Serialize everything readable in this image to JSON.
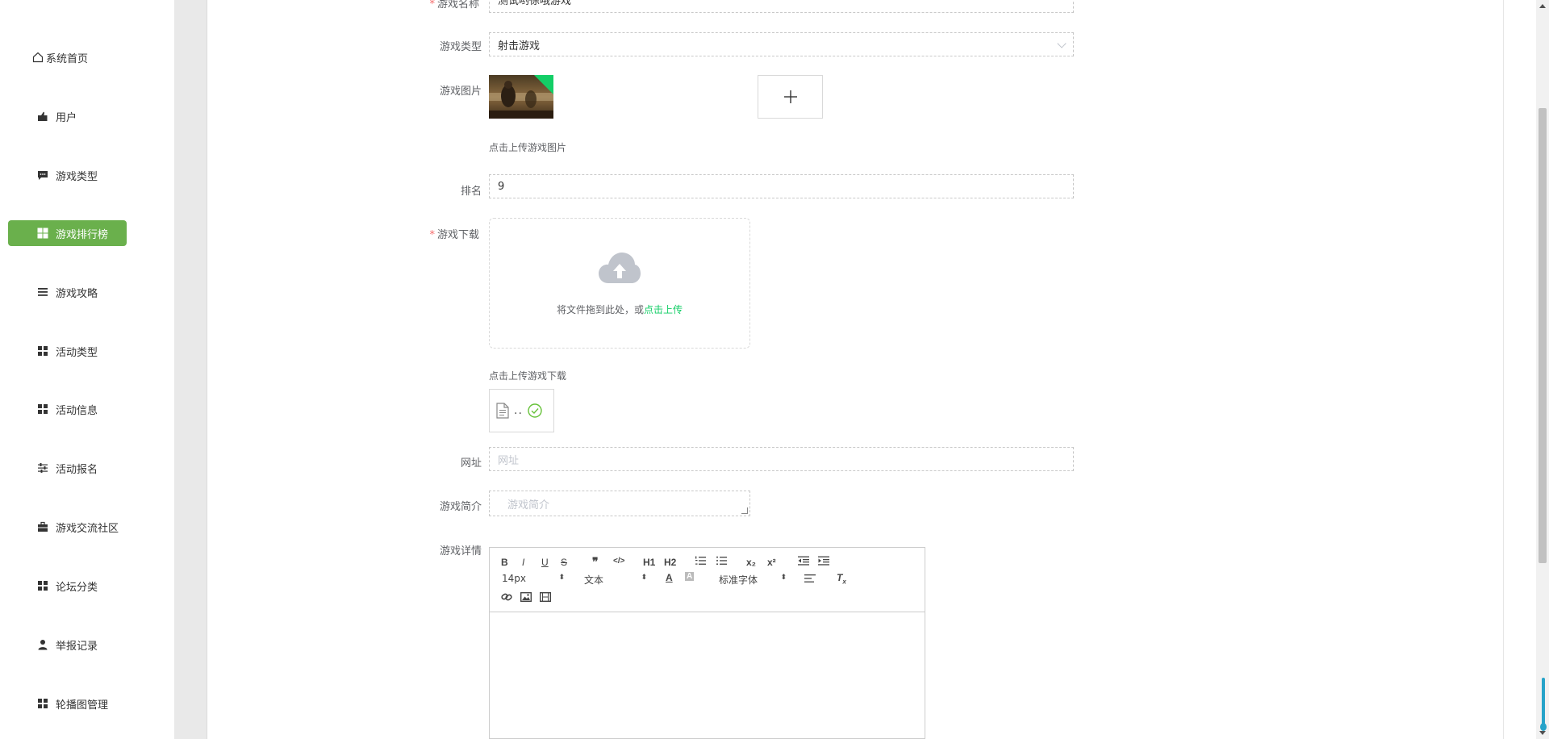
{
  "sidebar": {
    "items": [
      {
        "label": "系统首页",
        "icon": "home-icon",
        "active": false
      },
      {
        "label": "用户",
        "icon": "user-thumb-icon",
        "active": false
      },
      {
        "label": "游戏类型",
        "icon": "chat-icon",
        "active": false
      },
      {
        "label": "游戏排行榜",
        "icon": "grid-icon",
        "active": true
      },
      {
        "label": "游戏攻略",
        "icon": "list-icon",
        "active": false
      },
      {
        "label": "活动类型",
        "icon": "grid-icon",
        "active": false
      },
      {
        "label": "活动信息",
        "icon": "grid-icon",
        "active": false
      },
      {
        "label": "活动报名",
        "icon": "sliders-icon",
        "active": false
      },
      {
        "label": "游戏交流社区",
        "icon": "briefcase-icon",
        "active": false
      },
      {
        "label": "论坛分类",
        "icon": "grid-icon",
        "active": false
      },
      {
        "label": "举报记录",
        "icon": "person-icon",
        "active": false
      },
      {
        "label": "轮播图管理",
        "icon": "grid-icon",
        "active": false
      }
    ]
  },
  "form": {
    "name": {
      "label": "游戏名称",
      "value": "测试哟徐哦游戏"
    },
    "type": {
      "label": "游戏类型",
      "value": "射击游戏"
    },
    "image": {
      "label": "游戏图片",
      "hint": "点击上传游戏图片"
    },
    "rank": {
      "label": "排名",
      "value": "9"
    },
    "download": {
      "label": "游戏下载",
      "drag_text": "将文件拖到此处，或",
      "drag_link": "点击上传",
      "hint": "点击上传游戏下载",
      "file_name": ".."
    },
    "url": {
      "label": "网址",
      "placeholder": "网址"
    },
    "intro": {
      "label": "游戏简介",
      "placeholder": "游戏简介"
    },
    "detail": {
      "label": "游戏详情"
    }
  },
  "editor": {
    "size_value": "14px",
    "header_value": "文本",
    "font_value": "标准字体",
    "h1": "H1",
    "h2": "H2",
    "sub": "x₂",
    "sup": "x²"
  },
  "colors": {
    "accent": "#6ab04c",
    "link": "#13ce66",
    "required": "#f56c6c"
  }
}
